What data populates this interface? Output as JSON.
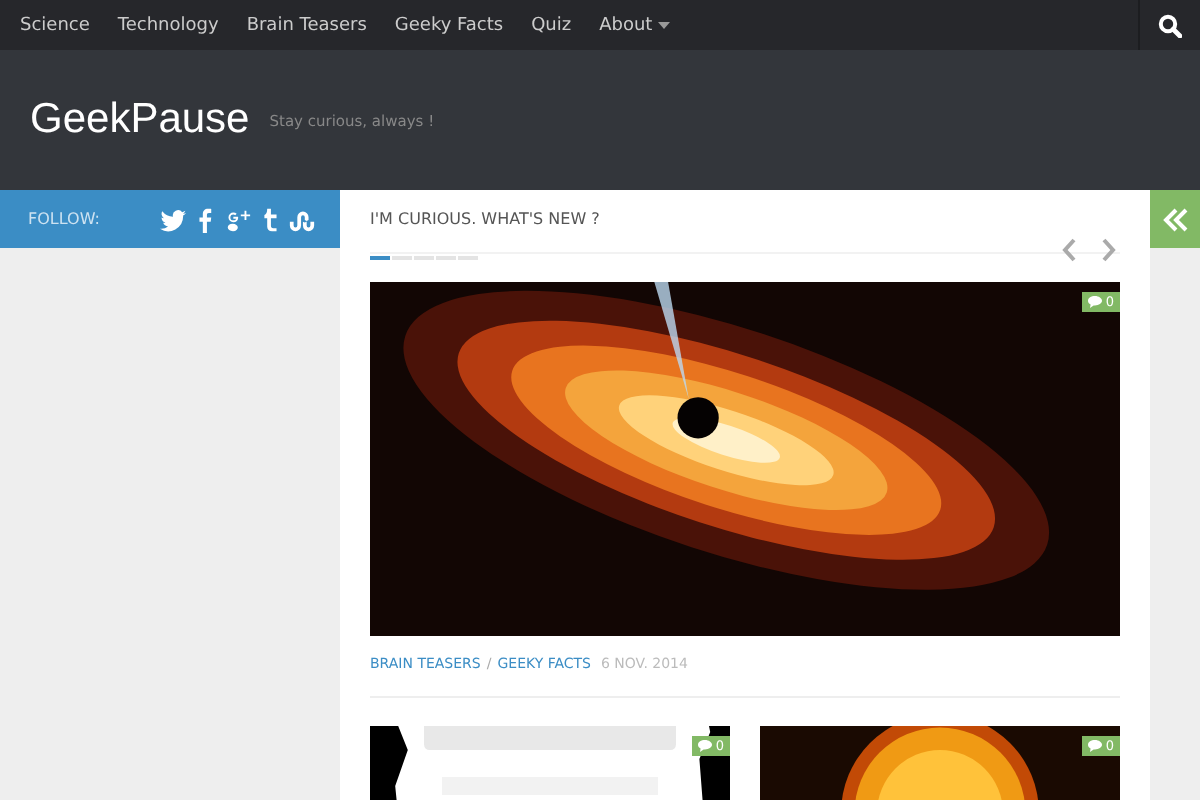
{
  "nav": {
    "items": [
      {
        "label": "Science",
        "has_dropdown": false
      },
      {
        "label": "Technology",
        "has_dropdown": false
      },
      {
        "label": "Brain Teasers",
        "has_dropdown": false
      },
      {
        "label": "Geeky Facts",
        "has_dropdown": false
      },
      {
        "label": "Quiz",
        "has_dropdown": false
      },
      {
        "label": "About",
        "has_dropdown": true
      }
    ]
  },
  "header": {
    "site_title": "GeekPause",
    "tagline": "Stay curious, always !"
  },
  "sidebar": {
    "follow_label": "FOLLOW:",
    "social": [
      {
        "kind": "twitter"
      },
      {
        "kind": "facebook"
      },
      {
        "kind": "googleplus"
      },
      {
        "kind": "tumblr"
      },
      {
        "kind": "stumbleupon"
      }
    ]
  },
  "featured": {
    "heading": "I'M CURIOUS. WHAT'S NEW ?",
    "slides": [
      {
        "selected": true
      },
      {
        "selected": false
      },
      {
        "selected": false
      },
      {
        "selected": false
      },
      {
        "selected": false
      }
    ],
    "post": {
      "comments": "0",
      "categories": [
        "BRAIN TEASERS",
        "GEEKY FACTS"
      ],
      "separator": "/",
      "date": "6 NOV. 2014"
    }
  },
  "posts": [
    {
      "comments": "0"
    },
    {
      "comments": "0"
    }
  ]
}
